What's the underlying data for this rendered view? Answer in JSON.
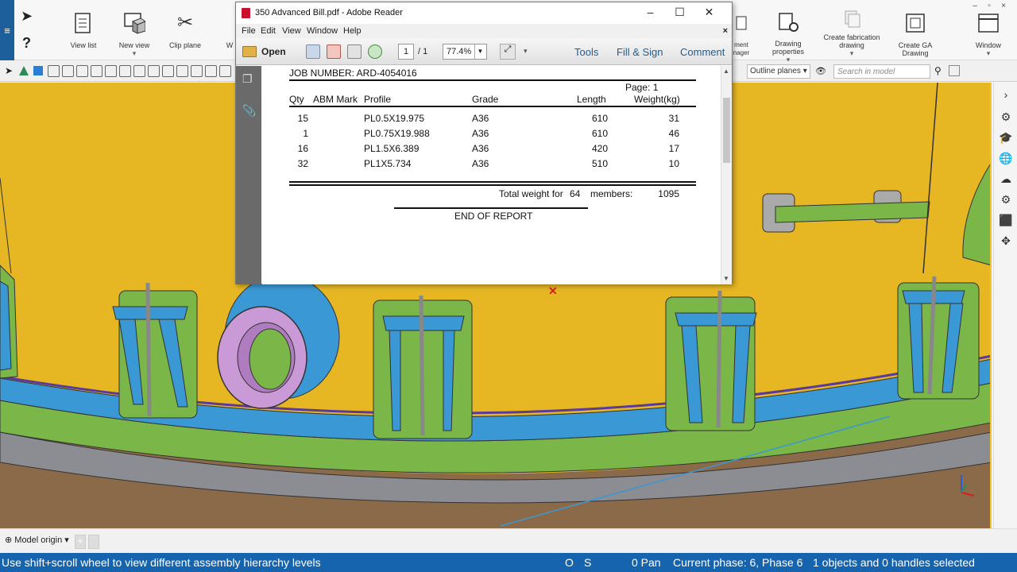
{
  "ribbon": {
    "buttons": [
      {
        "label": "View list"
      },
      {
        "label": "New view"
      },
      {
        "label": "Clip plane"
      },
      {
        "label": "W"
      },
      {
        "label": "ment\nnager"
      },
      {
        "label": "Drawing properties"
      },
      {
        "label": "Create fabrication\ndrawing"
      },
      {
        "label": "Create GA Drawing"
      },
      {
        "label": "Window"
      }
    ]
  },
  "toolbar2": {
    "outline_planes": "Outline planes",
    "search_placeholder": "Search in model"
  },
  "reader": {
    "title": "350  Advanced Bill.pdf - Adobe Reader",
    "menu": [
      "File",
      "Edit",
      "View",
      "Window",
      "Help"
    ],
    "open_label": "Open",
    "page_current": "1",
    "page_total": "/ 1",
    "zoom": "77.4%",
    "tabs": [
      "Tools",
      "Fill & Sign",
      "Comment"
    ]
  },
  "report": {
    "job_number": "JOB NUMBER: ARD-4054016",
    "page_label": "Page:  1",
    "headers": [
      "Qty",
      "ABM Mark",
      "Profile",
      "Grade",
      "Length",
      "Weight(kg)"
    ],
    "rows": [
      {
        "qty": "15",
        "mark": "",
        "profile": "PL0.5X19.975",
        "grade": "A36",
        "length": "610",
        "weight": "31"
      },
      {
        "qty": "1",
        "mark": "",
        "profile": "PL0.75X19.988",
        "grade": "A36",
        "length": "610",
        "weight": "46"
      },
      {
        "qty": "16",
        "mark": "",
        "profile": "PL1.5X6.389",
        "grade": "A36",
        "length": "420",
        "weight": "17"
      },
      {
        "qty": "32",
        "mark": "",
        "profile": "PL1X5.734",
        "grade": "A36",
        "length": "510",
        "weight": "10"
      }
    ],
    "total_weight_label": "Total weight for",
    "total_members": "64",
    "members_label": "members:",
    "total_weight": "1095",
    "end": "END OF REPORT"
  },
  "bottom": {
    "model_origin": "Model origin"
  },
  "status": {
    "hint": "Use shift+scroll wheel to view different assembly hierarchy levels",
    "o": "O",
    "s": "S",
    "pan": "0 Pan",
    "phase": "Current phase: 6, Phase 6",
    "selection": "1 objects and 0 handles selected"
  },
  "colors": {
    "viewport_bg": "#e6b623",
    "status_bar": "#1664ae",
    "accent_link": "#1f5d95"
  }
}
